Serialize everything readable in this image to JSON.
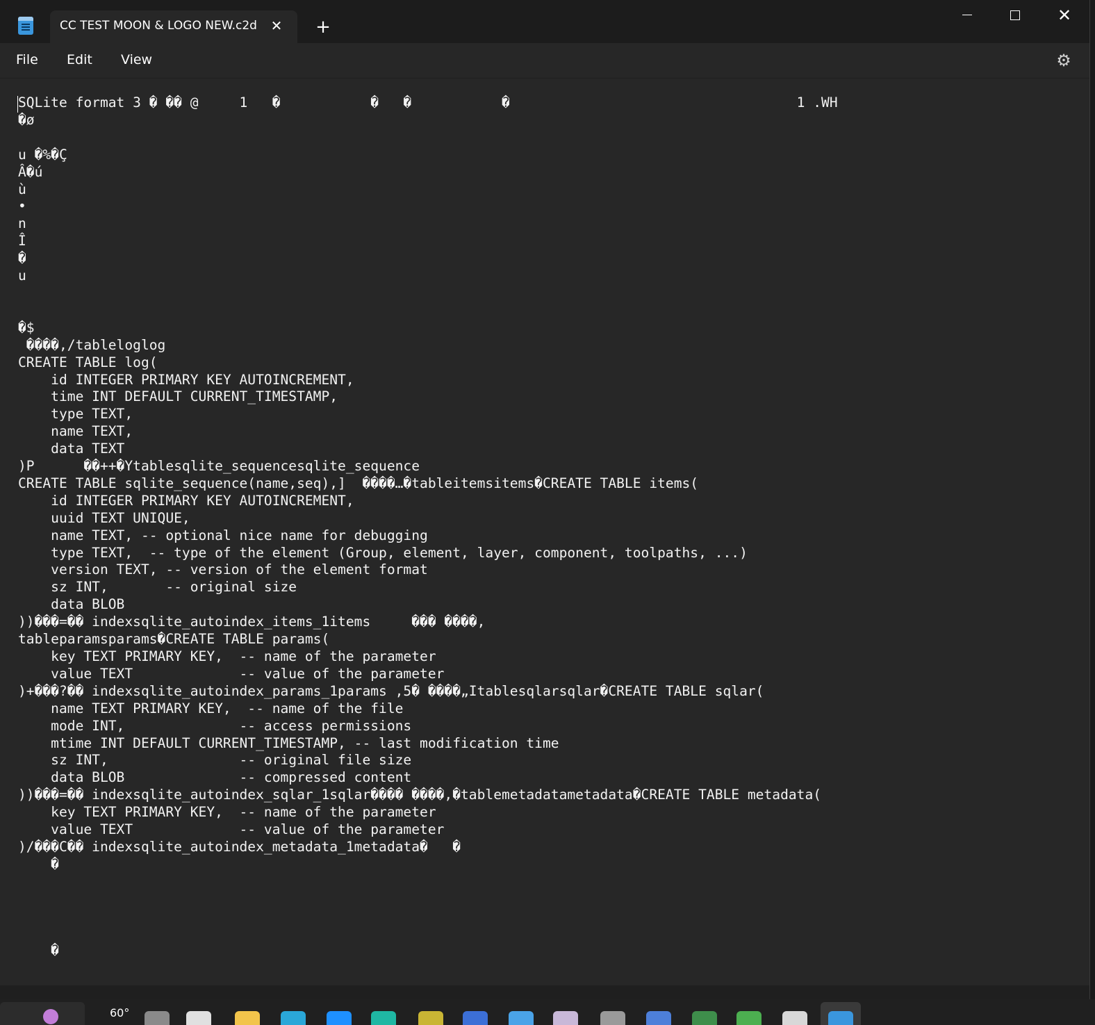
{
  "window": {
    "tab_title": "CC TEST MOON & LOGO NEW.c2d",
    "tab_close": "✕",
    "new_tab": "+",
    "close_glyph": "✕"
  },
  "menu": {
    "file": "File",
    "edit": "Edit",
    "view": "View",
    "settings_icon": "⚙"
  },
  "editor": {
    "content": "SQLite format 3 � �� @     1   �           �   �           �                                   1 .WH\n�ø\n\nu �%�Ç\nÂ�ú\nù\n•\nn\nÎ\n�\nu\n\n\n�$\n ����,/tableloglog\nCREATE TABLE log(\n    id INTEGER PRIMARY KEY AUTOINCREMENT,\n    time INT DEFAULT CURRENT_TIMESTAMP,\n    type TEXT,\n    name TEXT,\n    data TEXT\n)P      ��++�Ytablesqlite_sequencesqlite_sequence\nCREATE TABLE sqlite_sequence(name,seq),]  ����…�tableitemsitems�CREATE TABLE items(\n    id INTEGER PRIMARY KEY AUTOINCREMENT,\n    uuid TEXT UNIQUE,\n    name TEXT, -- optional nice name for debugging\n    type TEXT,  -- type of the element (Group, element, layer, component, toolpaths, ...)\n    version TEXT, -- version of the element format\n    sz INT,       -- original size\n    data BLOB\n))���=�� indexsqlite_autoindex_items_1items     ��� ����,\ntableparamsparams�CREATE TABLE params(\n    key TEXT PRIMARY KEY,  -- name of the parameter\n    value TEXT             -- value of the parameter\n)+���?�� indexsqlite_autoindex_params_1params ,5� ����„Itablesqlarsqlar�CREATE TABLE sqlar(\n    name TEXT PRIMARY KEY,  -- name of the file\n    mode INT,              -- access permissions\n    mtime INT DEFAULT CURRENT_TIMESTAMP, -- last modification time\n    sz INT,                -- original file size\n    data BLOB              -- compressed content\n))���=�� indexsqlite_autoindex_sqlar_1sqlar���� ����,�tablemetadatametadata�CREATE TABLE metadata(\n    key TEXT PRIMARY KEY,  -- name of the parameter\n    value TEXT             -- value of the parameter\n)/���C�� indexsqlite_autoindex_metadata_1metadata�   �\n    �\n\n\n\n\n    �"
  },
  "taskbar": {
    "temperature": "60°",
    "icons": [
      {
        "name": "settings-app-icon",
        "color": "#8a8a8a"
      },
      {
        "name": "calendar-app-icon",
        "color": "#e0e0e0"
      },
      {
        "name": "file-explorer-icon",
        "color": "#f2c44b"
      },
      {
        "name": "edge-browser-icon",
        "color": "#2aa7d8"
      },
      {
        "name": "skype-icon",
        "color": "#1e90ff"
      },
      {
        "name": "app-teal-icon",
        "color": "#1fb7a3"
      },
      {
        "name": "app-yellow-icon",
        "color": "#c9b534"
      },
      {
        "name": "gear-app-icon",
        "color": "#3c6fd6"
      },
      {
        "name": "drop-app-icon",
        "color": "#4aa3e8"
      },
      {
        "name": "crystal-app-icon",
        "color": "#c8b8d8"
      },
      {
        "name": "tool-app-icon",
        "color": "#9a9a9a"
      },
      {
        "name": "g-app-icon",
        "color": "#4d7fd9"
      },
      {
        "name": "cap-app-icon",
        "color": "#3e8e4b"
      },
      {
        "name": "green-app-icon",
        "color": "#4caf50"
      },
      {
        "name": "paper-app-icon",
        "color": "#d8d8d8"
      },
      {
        "name": "notepad-taskbar-icon",
        "color": "#3a96dd"
      }
    ]
  }
}
